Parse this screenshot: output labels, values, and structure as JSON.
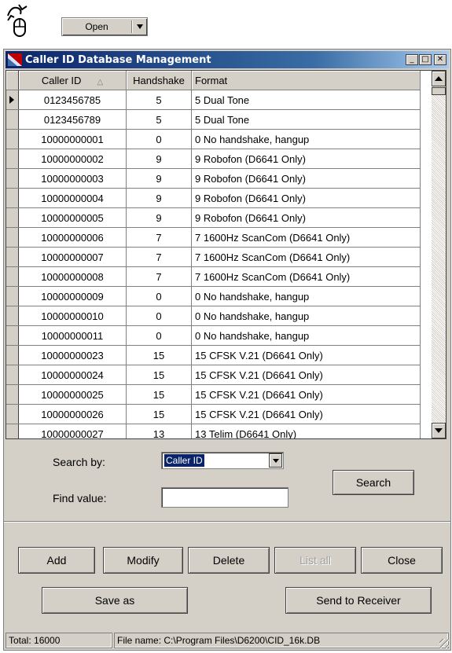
{
  "toolbar": {
    "open_label": "Open"
  },
  "window": {
    "title": "Caller ID Database Management",
    "min_symbol": "_",
    "max_symbol": "□",
    "close_symbol": "✕"
  },
  "grid": {
    "columns": [
      "Caller ID",
      "Handshake",
      "Format"
    ],
    "sort_indicator": "△",
    "rows": [
      {
        "caller_id": "0123456785",
        "handshake": "5",
        "format": "5  Dual Tone"
      },
      {
        "caller_id": "0123456789",
        "handshake": "5",
        "format": "5  Dual Tone"
      },
      {
        "caller_id": "10000000001",
        "handshake": "0",
        "format": "0  No handshake, hangup"
      },
      {
        "caller_id": "10000000002",
        "handshake": "9",
        "format": "9  Robofon (D6641 Only)"
      },
      {
        "caller_id": "10000000003",
        "handshake": "9",
        "format": "9  Robofon (D6641 Only)"
      },
      {
        "caller_id": "10000000004",
        "handshake": "9",
        "format": "9  Robofon (D6641 Only)"
      },
      {
        "caller_id": "10000000005",
        "handshake": "9",
        "format": "9  Robofon (D6641 Only)"
      },
      {
        "caller_id": "10000000006",
        "handshake": "7",
        "format": "7  1600Hz ScanCom (D6641 Only)"
      },
      {
        "caller_id": "10000000007",
        "handshake": "7",
        "format": "7  1600Hz ScanCom (D6641 Only)"
      },
      {
        "caller_id": "10000000008",
        "handshake": "7",
        "format": "7  1600Hz ScanCom (D6641 Only)"
      },
      {
        "caller_id": "10000000009",
        "handshake": "0",
        "format": "0  No handshake, hangup"
      },
      {
        "caller_id": "10000000010",
        "handshake": "0",
        "format": "0  No handshake, hangup"
      },
      {
        "caller_id": "10000000011",
        "handshake": "0",
        "format": "0  No handshake, hangup"
      },
      {
        "caller_id": "10000000023",
        "handshake": "15",
        "format": "15  CFSK V.21 (D6641 Only)"
      },
      {
        "caller_id": "10000000024",
        "handshake": "15",
        "format": "15  CFSK V.21 (D6641 Only)"
      },
      {
        "caller_id": "10000000025",
        "handshake": "15",
        "format": "15  CFSK V.21 (D6641 Only)"
      },
      {
        "caller_id": "10000000026",
        "handshake": "15",
        "format": "15  CFSK V.21 (D6641 Only)"
      },
      {
        "caller_id": "10000000027",
        "handshake": "13",
        "format": "13  Telim (D6641 Only)"
      }
    ]
  },
  "search": {
    "search_by_label": "Search by:",
    "search_by_value": "Caller ID",
    "find_value_label": "Find value:",
    "find_value": "",
    "search_button": "Search"
  },
  "buttons": {
    "add": "Add",
    "modify": "Modify",
    "delete": "Delete",
    "list_all": "List all",
    "close": "Close",
    "save_as": "Save as",
    "send_to_receiver": "Send to Receiver"
  },
  "status": {
    "total": "Total: 16000",
    "file_name": "File name: C:\\Program Files\\D6200\\CID_16k.DB"
  },
  "colors": {
    "title_bar": "#0a246a",
    "face": "#d4d0c8"
  }
}
